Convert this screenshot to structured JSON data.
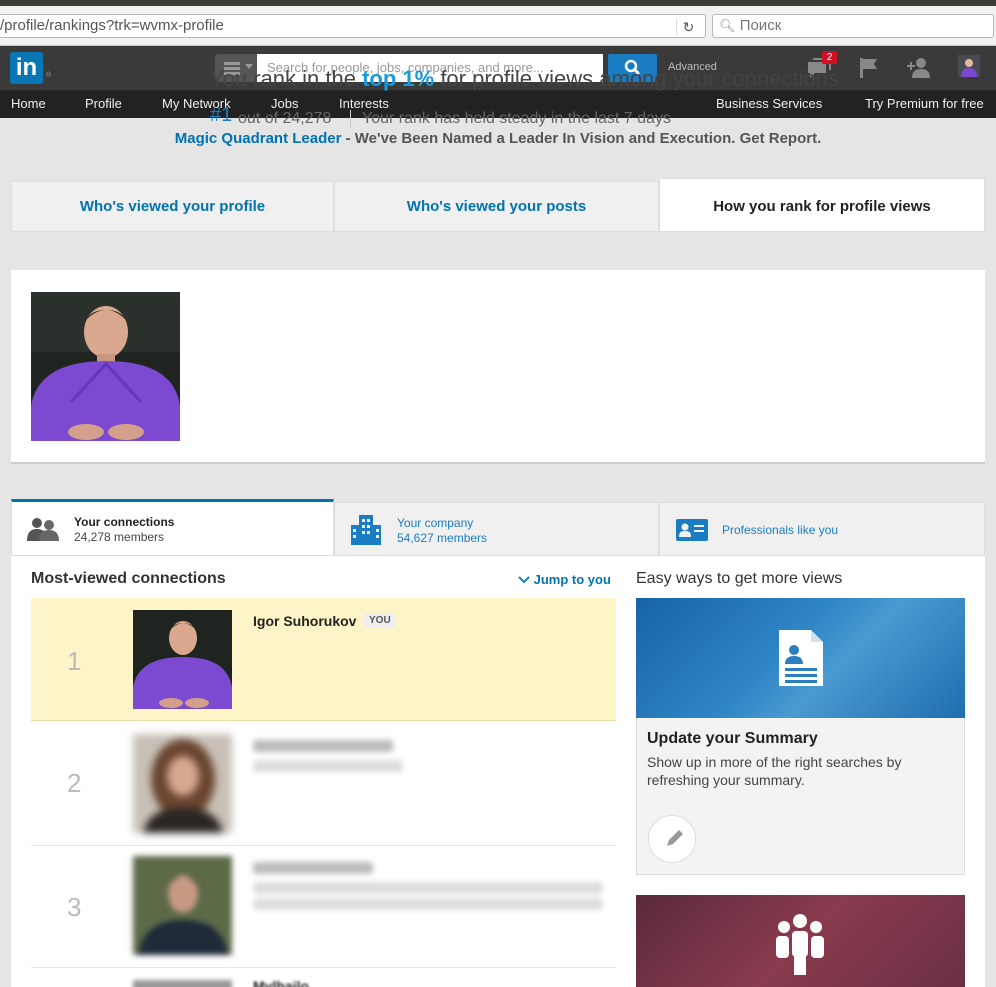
{
  "browser": {
    "url": "/profile/rankings?trk=wvmx-profile",
    "url_prefix": "…",
    "reload_icon": "reload-icon",
    "search_placeholder": "Поиск",
    "search_icon": "magnifier-icon"
  },
  "header": {
    "logo_text": "in",
    "logo_mark": "®",
    "search_placeholder": "Search for people, jobs, companies, and more...",
    "advanced_label": "Advanced",
    "notification_count": "2",
    "icons": [
      "menu-icon",
      "search-icon",
      "messages-icon",
      "flag-icon",
      "add-connection-icon",
      "avatar"
    ]
  },
  "nav": {
    "items": [
      "Home",
      "Profile",
      "My Network",
      "Jobs",
      "Interests"
    ],
    "right_items": [
      "Business Services",
      "Try Premium for free"
    ]
  },
  "banner": {
    "highlight": "Magic Quadrant Leader",
    "text": " - We've Been Named a Leader In Vision and Execution. Get Report."
  },
  "tabs": [
    {
      "label": "Who's viewed your profile"
    },
    {
      "label": "Who's viewed your posts"
    },
    {
      "label": "How you rank for profile views"
    }
  ],
  "rank": {
    "pre": "You rank in the ",
    "highlight": "top 1%",
    "post": " for profile views among your connections.",
    "number": "#1",
    "out_of": "out of 24,278",
    "steady": "Your rank has held steady in the last 7 days"
  },
  "subtabs": [
    {
      "title": "Your connections",
      "sub": "24,278 members"
    },
    {
      "title": "Your company",
      "sub": "54,627 members"
    },
    {
      "title": "Professionals like you",
      "sub": ""
    }
  ],
  "list": {
    "title": "Most-viewed connections",
    "jump_label": "Jump to you",
    "rows": [
      {
        "rank": "1",
        "name": "Igor Suhorukov",
        "badge": "YOU"
      },
      {
        "rank": "2"
      },
      {
        "rank": "3"
      },
      {
        "name": "Mylhailo"
      }
    ]
  },
  "sidebar": {
    "title": "Easy ways to get more views",
    "card1": {
      "title": "Update your Summary",
      "desc": "Show up in more of the right searches by refreshing your summary."
    }
  },
  "colors": {
    "accent": "#0073b1",
    "highlight_row": "#fdf4c8",
    "header_bg": "#3a3a3a",
    "nav_bg": "#222222",
    "notification": "#d11124"
  }
}
